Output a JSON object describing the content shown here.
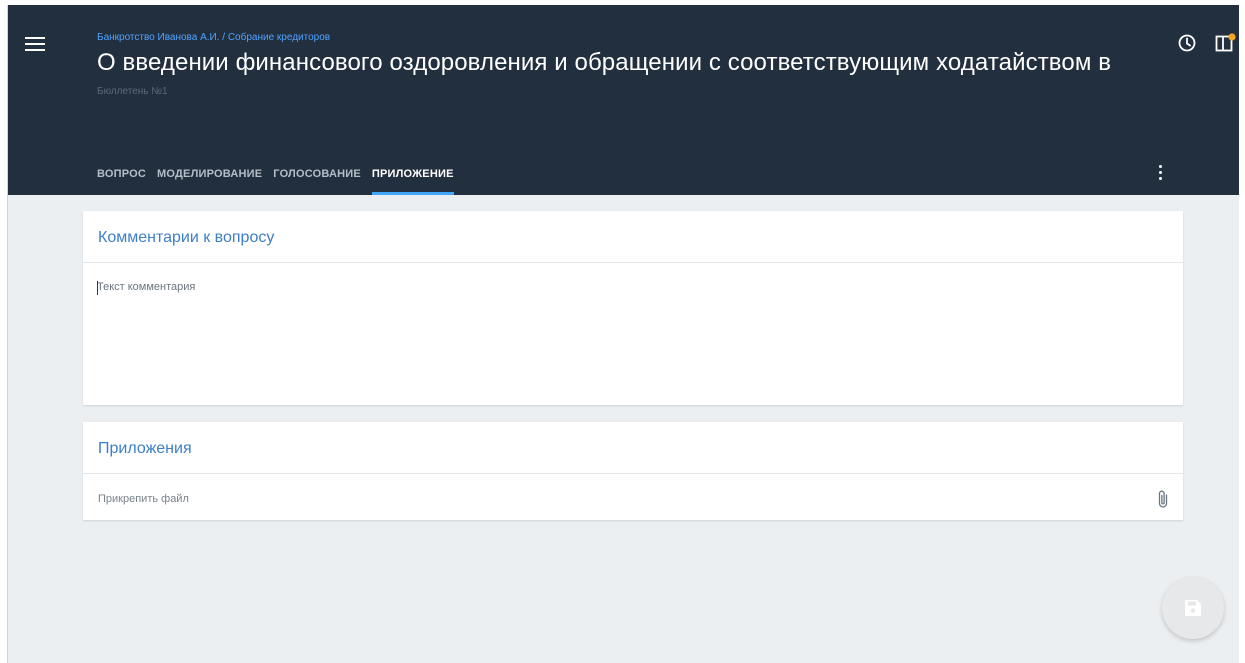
{
  "header": {
    "breadcrumb": "Банкротство Иванова А.И. / Собрание кредиторов",
    "title": "О введении финансового оздоровления и обращении с соответствующим ходатайством в арби…",
    "subtitle": "Бюллетень №1",
    "icons": [
      "menu-icon",
      "history-icon",
      "panel-icon",
      "more-vert-icon"
    ],
    "notification_dot_color": "#f5a623"
  },
  "tabs": [
    {
      "label": "ВОПРОС",
      "active": false
    },
    {
      "label": "МОДЕЛИРОВАНИЕ",
      "active": false
    },
    {
      "label": "ГОЛОСОВАНИЕ",
      "active": false
    },
    {
      "label": "ПРИЛОЖЕНИЕ",
      "active": true
    }
  ],
  "comments": {
    "title": "Комментарии к вопросу",
    "placeholder": "Текст комментария",
    "value": ""
  },
  "attachments": {
    "title": "Приложения",
    "attach_label": "Прикрепить файл",
    "icon": "paperclip-icon"
  },
  "fab": {
    "icon": "save-icon"
  },
  "colors": {
    "header_bg": "#222f3e",
    "accent": "#42a5f5",
    "breadcrumb": "#4fa3ff",
    "card_title": "#3d7fc7",
    "page_bg": "#eceff1"
  }
}
